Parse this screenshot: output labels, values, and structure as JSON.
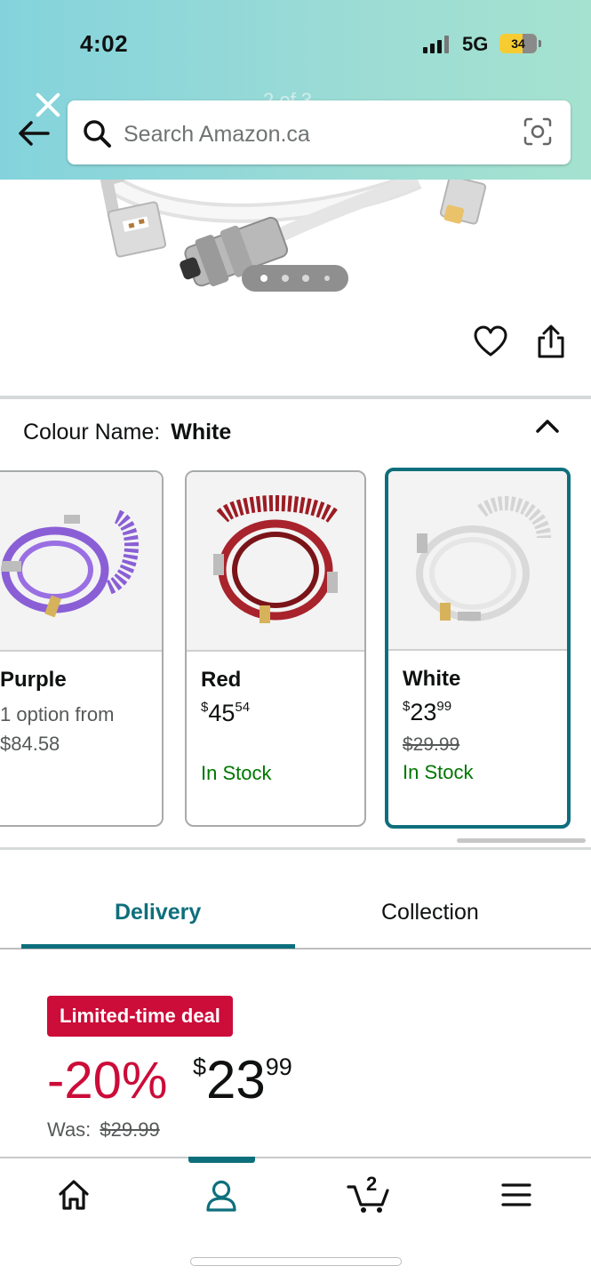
{
  "status_bar": {
    "time": "4:02",
    "network": "5G",
    "battery": "34"
  },
  "header": {
    "page_counter": "2 of 3",
    "search_placeholder": "Search Amazon.ca"
  },
  "gallery": {
    "dot_count": 4,
    "active_dot": 1
  },
  "colour": {
    "label": "Colour Name:",
    "selected": "White"
  },
  "variants": [
    {
      "name": "Purple",
      "options_line1": "1 option from",
      "options_line2": "$84.58"
    },
    {
      "name": "Red",
      "currency": "$",
      "dollars": "45",
      "cents": "54",
      "stock": "In Stock"
    },
    {
      "name": "White",
      "currency": "$",
      "dollars": "23",
      "cents": "99",
      "was": "$29.99",
      "stock": "In Stock"
    }
  ],
  "tabs": {
    "delivery": "Delivery",
    "collection": "Collection"
  },
  "deal": {
    "badge": "Limited-time deal",
    "discount": "-20%",
    "currency": "$",
    "dollars": "23",
    "cents": "99",
    "was_label": "Was:",
    "was_price": "$29.99"
  },
  "cart": {
    "count": "2"
  },
  "colors": {
    "accent": "#0e6f7c",
    "deal": "#cc0c39",
    "in_stock": "#007600"
  }
}
